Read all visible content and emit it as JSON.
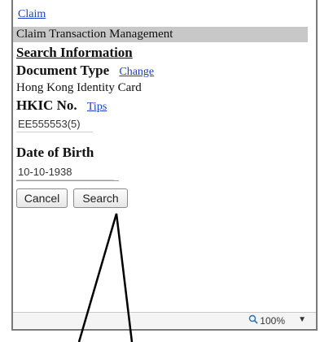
{
  "breadcrumb": {
    "claim_link": "Claim"
  },
  "section": {
    "title": "Claim Transaction Management"
  },
  "search": {
    "heading": "Search Information",
    "document_type_label": "Document Type",
    "change_link": "Change",
    "document_type_value": "Hong Kong Identity Card",
    "hkic_label": "HKIC No.",
    "tips_link": "Tips",
    "hkic_value": "EE555553(5)",
    "dob_label": "Date of Birth",
    "dob_value": "10-10-1938"
  },
  "buttons": {
    "cancel": "Cancel",
    "search": "Search"
  },
  "statusbar": {
    "zoom": "100%",
    "zoom_icon": "magnifier-icon",
    "dropdown_icon": "chevron-down-icon"
  },
  "colors": {
    "link": "#1a3fc8",
    "section_bar": "#c8c8c8"
  }
}
